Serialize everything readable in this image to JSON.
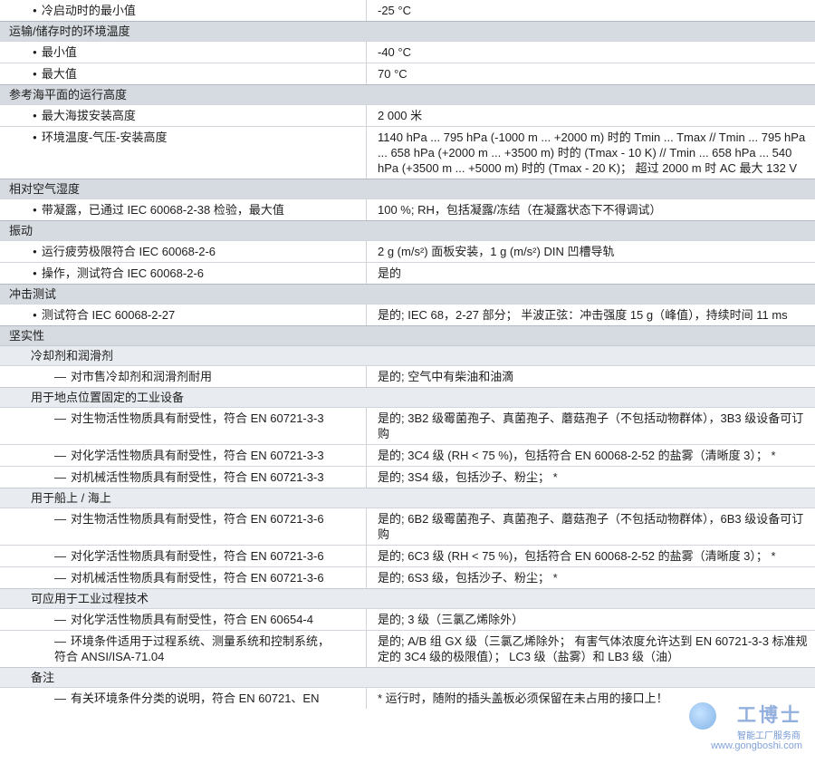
{
  "sections": [
    {
      "type": "row",
      "style": "b",
      "key": "冷启动时的最小值",
      "val": "-25 °C"
    },
    {
      "type": "section",
      "title": "运输/储存时的环境温度"
    },
    {
      "type": "row",
      "style": "b",
      "key": "最小值",
      "val": "-40 °C"
    },
    {
      "type": "row",
      "style": "b",
      "key": "最大值",
      "val": "70 °C"
    },
    {
      "type": "section",
      "title": "参考海平面的运行高度"
    },
    {
      "type": "row",
      "style": "b",
      "key": "最大海拔安装高度",
      "val": "2 000 米"
    },
    {
      "type": "row",
      "style": "b",
      "key": "环境温度-气压-安装高度",
      "val": "1140 hPa ... 795 hPa (-1000 m ... +2000 m) 时的 Tmin ... Tmax // Tmin ... 795 hPa ... 658 hPa (+2000 m ... +3500 m) 时的 (Tmax - 10 K) // Tmin ... 658 hPa ... 540 hPa (+3500 m ... +5000 m) 时的 (Tmax - 20 K)； 超过 2000 m 时 AC 最大 132 V"
    },
    {
      "type": "section",
      "title": "相对空气湿度"
    },
    {
      "type": "row",
      "style": "b",
      "key": "带凝露，已通过 IEC 60068-2-38 检验，最大值",
      "val": "100 %; RH，包括凝露/冻结（在凝露状态下不得调试）"
    },
    {
      "type": "section",
      "title": "振动"
    },
    {
      "type": "row",
      "style": "b",
      "key": "运行疲劳极限符合 IEC 60068-2-6",
      "val": "2 g (m/s²) 面板安装，1 g (m/s²) DIN 凹槽导轨"
    },
    {
      "type": "row",
      "style": "b",
      "key": "操作，测试符合 IEC 60068-2-6",
      "val": "是的"
    },
    {
      "type": "section",
      "title": "冲击测试"
    },
    {
      "type": "row",
      "style": "b",
      "key": "测试符合 IEC 60068-2-27",
      "val": "是的; IEC 68，2-27 部分； 半波正弦：冲击强度 15 g（峰值），持续时间 11 ms"
    },
    {
      "type": "section",
      "title": "坚实性"
    },
    {
      "type": "sub",
      "title": "冷却剂和润滑剂"
    },
    {
      "type": "row",
      "style": "d",
      "key": "对市售冷却剂和润滑剂耐用",
      "val": "是的; 空气中有柴油和油滴"
    },
    {
      "type": "sub",
      "title": "用于地点位置固定的工业设备"
    },
    {
      "type": "row",
      "style": "d",
      "key": "对生物活性物质具有耐受性，符合 EN 60721-3-3",
      "val": "是的; 3B2 级霉菌孢子、真菌孢子、蘑菇孢子（不包括动物群体），3B3 级设备可订购"
    },
    {
      "type": "row",
      "style": "d",
      "key": "对化学活性物质具有耐受性，符合 EN 60721-3-3",
      "val": "是的; 3C4 级 (RH < 75 %)，包括符合 EN 60068-2-52 的盐雾（清晰度 3）； *"
    },
    {
      "type": "row",
      "style": "d",
      "key": "对机械活性物质具有耐受性，符合 EN 60721-3-3",
      "val": "是的; 3S4 级，包括沙子、粉尘； *"
    },
    {
      "type": "sub",
      "title": "用于船上 / 海上"
    },
    {
      "type": "row",
      "style": "d",
      "key": "对生物活性物质具有耐受性，符合 EN 60721-3-6",
      "val": "是的; 6B2 级霉菌孢子、真菌孢子、蘑菇孢子（不包括动物群体），6B3 级设备可订购"
    },
    {
      "type": "row",
      "style": "d",
      "key": "对化学活性物质具有耐受性，符合 EN 60721-3-6",
      "val": "是的; 6C3 级 (RH < 75 %)，包括符合 EN 60068-2-52 的盐雾（清晰度 3）； *"
    },
    {
      "type": "row",
      "style": "d",
      "key": "对机械活性物质具有耐受性，符合 EN 60721-3-6",
      "val": "是的; 6S3 级，包括沙子、粉尘； *"
    },
    {
      "type": "sub",
      "title": "可应用于工业过程技术"
    },
    {
      "type": "row",
      "style": "d",
      "key": "对化学活性物质具有耐受性，符合 EN 60654-4",
      "val": "是的; 3 级（三氯乙烯除外）"
    },
    {
      "type": "row",
      "style": "d",
      "key": "环境条件适用于过程系统、测量系统和控制系统，\n符合 ANSI/ISA-71.04",
      "val": "是的; A/B 组 GX 级（三氯乙烯除外； 有害气体浓度允许达到 EN 60721-3-3 标准规定的 3C4 级的极限值）； LC3 级（盐雾）和 LB3 级（油）"
    },
    {
      "type": "sub",
      "title": "备注"
    },
    {
      "type": "row",
      "style": "d",
      "key": "有关环境条件分类的说明，符合 EN 60721、EN",
      "val": "* 运行时，随附的插头盖板必须保留在未占用的接口上！"
    }
  ],
  "watermark": {
    "logo": "工博士",
    "subtitle": "智能工厂服务商",
    "url": "www.gongboshi.com"
  }
}
